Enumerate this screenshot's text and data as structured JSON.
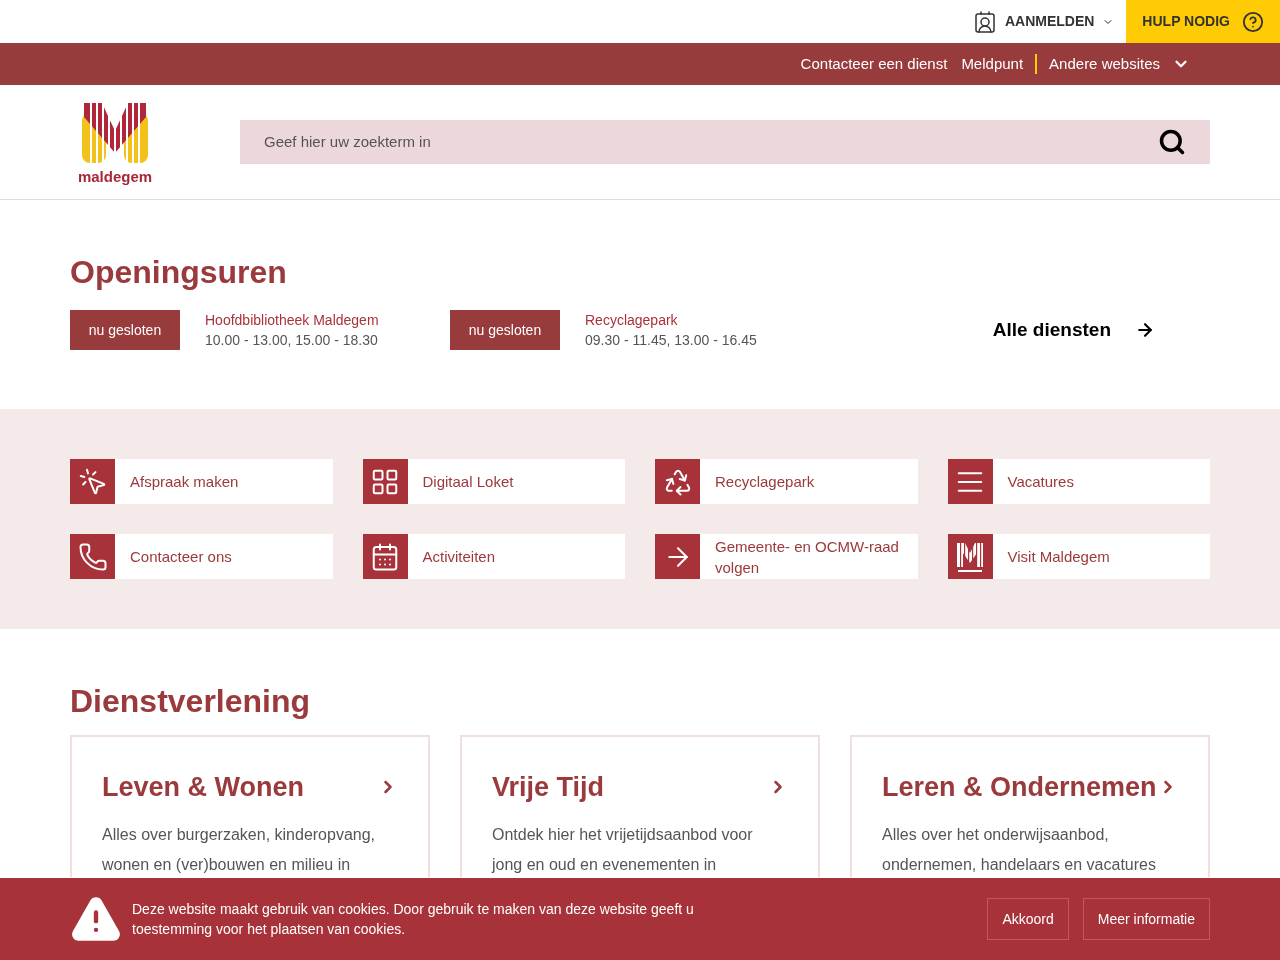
{
  "top_bar": {
    "login": "AANMELDEN",
    "help": "HULP NODIG"
  },
  "nav": {
    "links": [
      "Contacteer een dienst",
      "Meldpunt"
    ],
    "other": "Andere websites"
  },
  "header": {
    "logo_text": "maldegem",
    "search": {
      "placeholder": "Geef hier uw zoekterm in"
    }
  },
  "opening_hours": {
    "title": "Openingsuren",
    "items": [
      {
        "status": "nu gesloten",
        "name": "Hoofdbibliotheek Maldegem",
        "hours": "10.00 - 13.00, 15.00 - 18.30"
      },
      {
        "status": "nu gesloten",
        "name": "Recyclagepark",
        "hours": "09.30 - 11.45, 13.00 - 16.45"
      }
    ],
    "all_link": "Alle diensten"
  },
  "quick_links": [
    "Afspraak maken",
    "Digitaal Loket",
    "Recyclagepark",
    "Vacatures",
    "Contacteer ons",
    "Activiteiten",
    "Gemeente- en OCMW-raad volgen",
    "Visit Maldegem"
  ],
  "services": {
    "title": "Dienstverlening",
    "cards": [
      {
        "title": "Leven & Wonen",
        "text": "Alles over burgerzaken, kinderopvang, wonen en (ver)bouwen en milieu in"
      },
      {
        "title": "Vrije Tijd",
        "text": "Ontdek hier het vrijetijdsaanbod voor jong en oud en evenementen in"
      },
      {
        "title": "Leren & Ondernemen",
        "text": "Alles over het onderwijsaanbod, ondernemen, handelaars en vacatures"
      }
    ]
  },
  "cookie_bar": {
    "text": "Deze website maakt gebruik van cookies. Door gebruik te maken van deze website geeft u toestemming voor het plaatsen van cookies.",
    "buttons": [
      "Akkoord",
      "Meer informatie"
    ]
  }
}
